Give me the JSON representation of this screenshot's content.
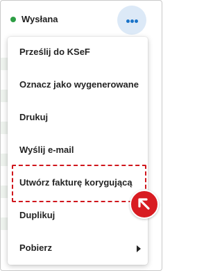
{
  "status": {
    "label": "Wysłana",
    "color": "#2e9e45"
  },
  "actions_button": {
    "icon": "more-horizontal-icon",
    "accent": "#1a73c8"
  },
  "menu": {
    "items": [
      {
        "label": "Prześlij do KSeF"
      },
      {
        "label": "Oznacz jako wygenerowane"
      },
      {
        "label": "Drukuj"
      },
      {
        "label": "Wyślij e-mail"
      },
      {
        "label": "Utwórz fakturę korygującą",
        "highlighted": true
      },
      {
        "label": "Duplikuj"
      },
      {
        "label": "Pobierz",
        "has_submenu": true
      }
    ]
  },
  "annotation": {
    "highlight_color": "#d0161c",
    "pointer_icon": "arrow-up-left-icon"
  }
}
